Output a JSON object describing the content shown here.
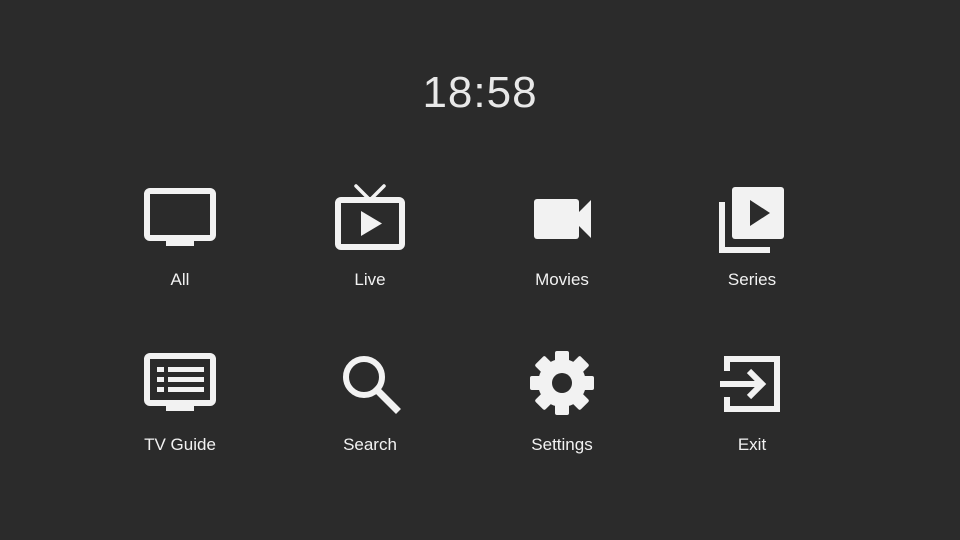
{
  "clock": {
    "time": "18:58"
  },
  "menu": {
    "items": [
      {
        "label": "All",
        "icon": "tv-icon"
      },
      {
        "label": "Live",
        "icon": "live-tv-icon"
      },
      {
        "label": "Movies",
        "icon": "video-camera-icon"
      },
      {
        "label": "Series",
        "icon": "video-library-icon"
      },
      {
        "label": "TV Guide",
        "icon": "tv-guide-icon"
      },
      {
        "label": "Search",
        "icon": "search-icon"
      },
      {
        "label": "Settings",
        "icon": "gear-icon"
      },
      {
        "label": "Exit",
        "icon": "exit-icon"
      }
    ]
  },
  "colors": {
    "background": "#2b2b2b",
    "foreground": "#f2f2f2"
  }
}
